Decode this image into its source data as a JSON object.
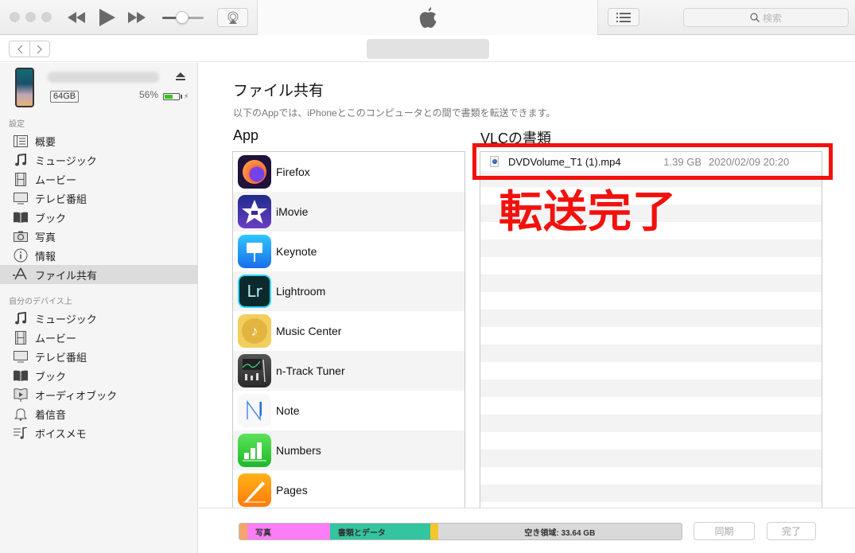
{
  "window": {
    "toolbar": {
      "search_placeholder": "検索",
      "search_icon": "magnifier-icon",
      "controls": [
        "rewind-icon",
        "play-icon",
        "fast-forward-icon",
        "volume-slider",
        "airplay-icon"
      ],
      "volume_level": 0.45,
      "view_toggle_icon": "list-icon"
    },
    "nav": {
      "back_icon": "chevron-left-icon",
      "forward_icon": "chevron-right-icon"
    }
  },
  "sidebar": {
    "device": {
      "capacity": "64GB",
      "battery_percent_label": "56%",
      "battery_level": 0.56,
      "battery_color": "#32c611"
    },
    "sections": [
      {
        "label": "設定",
        "items": [
          {
            "label": "概要",
            "icon": "summary-list-icon"
          },
          {
            "label": "ミュージック",
            "icon": "music-note-icon"
          },
          {
            "label": "ムービー",
            "icon": "film-icon"
          },
          {
            "label": "テレビ番組",
            "icon": "tv-icon"
          },
          {
            "label": "ブック",
            "icon": "book-icon"
          },
          {
            "label": "写真",
            "icon": "camera-icon"
          },
          {
            "label": "情報",
            "icon": "info-icon"
          },
          {
            "label": "ファイル共有",
            "icon": "app-store-icon",
            "selected": true
          }
        ]
      },
      {
        "label": "自分のデバイス上",
        "items": [
          {
            "label": "ミュージック",
            "icon": "music-note-icon"
          },
          {
            "label": "ムービー",
            "icon": "film-icon"
          },
          {
            "label": "テレビ番組",
            "icon": "tv-icon"
          },
          {
            "label": "ブック",
            "icon": "book-icon"
          },
          {
            "label": "オーディオブック",
            "icon": "audiobook-icon"
          },
          {
            "label": "着信音",
            "icon": "bell-icon"
          },
          {
            "label": "ボイスメモ",
            "icon": "voice-memo-icon"
          }
        ]
      }
    ]
  },
  "main": {
    "title": "ファイル共有",
    "description": "以下のAppでは、iPhoneとこのコンピュータとの間で書類を転送できます。",
    "apps_header": "App",
    "apps": [
      {
        "name": "Firefox",
        "icon": "firefox-icon"
      },
      {
        "name": "iMovie",
        "icon": "imovie-icon"
      },
      {
        "name": "Keynote",
        "icon": "keynote-icon"
      },
      {
        "name": "Lightroom",
        "icon": "lightroom-icon"
      },
      {
        "name": "Music Center",
        "icon": "music-center-icon"
      },
      {
        "name": "n-Track Tuner",
        "icon": "ntrack-tuner-icon"
      },
      {
        "name": "Note",
        "icon": "note-icon"
      },
      {
        "name": "Numbers",
        "icon": "numbers-icon"
      },
      {
        "name": "Pages",
        "icon": "pages-icon"
      }
    ],
    "docs_header": "VLCの書類",
    "documents": [
      {
        "name": "DVDVolume_T1 (1).mp4",
        "size": "1.39 GB",
        "date": "2020/02/09 20:20",
        "icon": "video-file-icon"
      }
    ],
    "annotation": "転送完了",
    "annotation_color": "#f2110d"
  },
  "footer": {
    "storage": [
      {
        "label": "",
        "fraction": 0.011,
        "color": "#f5a46b"
      },
      {
        "label": "写真",
        "fraction": 0.19,
        "color": "#fb7ef7"
      },
      {
        "label": "書類とデータ",
        "fraction": 0.23,
        "color": "#33c59f"
      },
      {
        "label": "",
        "fraction": 0.008,
        "color": "#f6c62b"
      },
      {
        "label": "空き領域: 33.64 GB",
        "fraction": 0.561,
        "color": "#d9d9d9"
      }
    ],
    "sync_label": "同期",
    "done_label": "完了"
  }
}
